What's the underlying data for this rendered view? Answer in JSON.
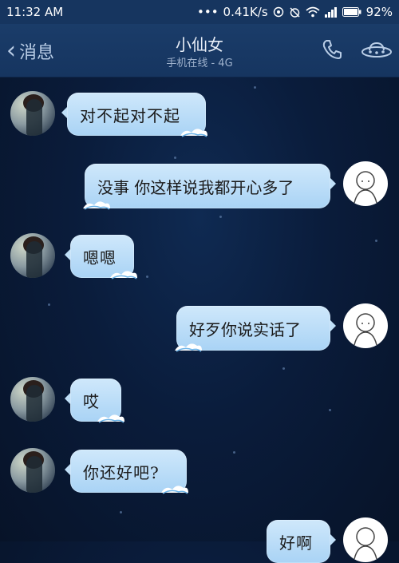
{
  "status_bar": {
    "time": "11:32 AM",
    "network_speed": "0.41K/s",
    "battery": "92%"
  },
  "header": {
    "back_label": "消息",
    "contact_name": "小仙女",
    "contact_status": "手机在线 - 4G"
  },
  "icons": {
    "back": "chevron-left-icon",
    "call": "phone-icon",
    "more": "ufo-icon"
  },
  "messages": [
    {
      "side": "left",
      "text": "对不起对不起"
    },
    {
      "side": "right",
      "text": "没事 你这样说我都开心多了"
    },
    {
      "side": "left",
      "text": "嗯嗯"
    },
    {
      "side": "right",
      "text": "好歹你说实话了"
    },
    {
      "side": "left",
      "text": "哎"
    },
    {
      "side": "left",
      "text": "你还好吧?"
    },
    {
      "side": "right",
      "text": "好啊"
    }
  ],
  "colors": {
    "background": "#0a1c3b",
    "header": "#163560",
    "bubble": "#b9dcf7"
  }
}
